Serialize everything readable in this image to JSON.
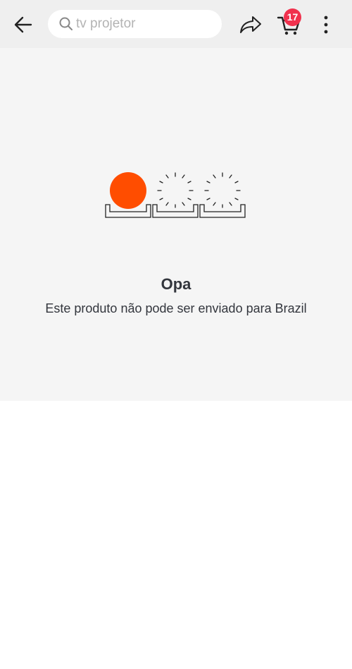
{
  "header": {
    "search_placeholder": "tv projetor",
    "cart_count": "17",
    "icons": {
      "back": "back-arrow-icon",
      "search": "search-icon",
      "share": "share-icon",
      "cart": "cart-icon",
      "more": "more-vertical-icon"
    }
  },
  "message": {
    "title": "Opa",
    "body": "Este produto não pode ser enviado para Brazil"
  },
  "colors": {
    "accent": "#ff4d00",
    "badge": "#f0314d",
    "header_bg": "#efefef",
    "panel_bg": "#f5f5f5",
    "text": "#33363d"
  }
}
